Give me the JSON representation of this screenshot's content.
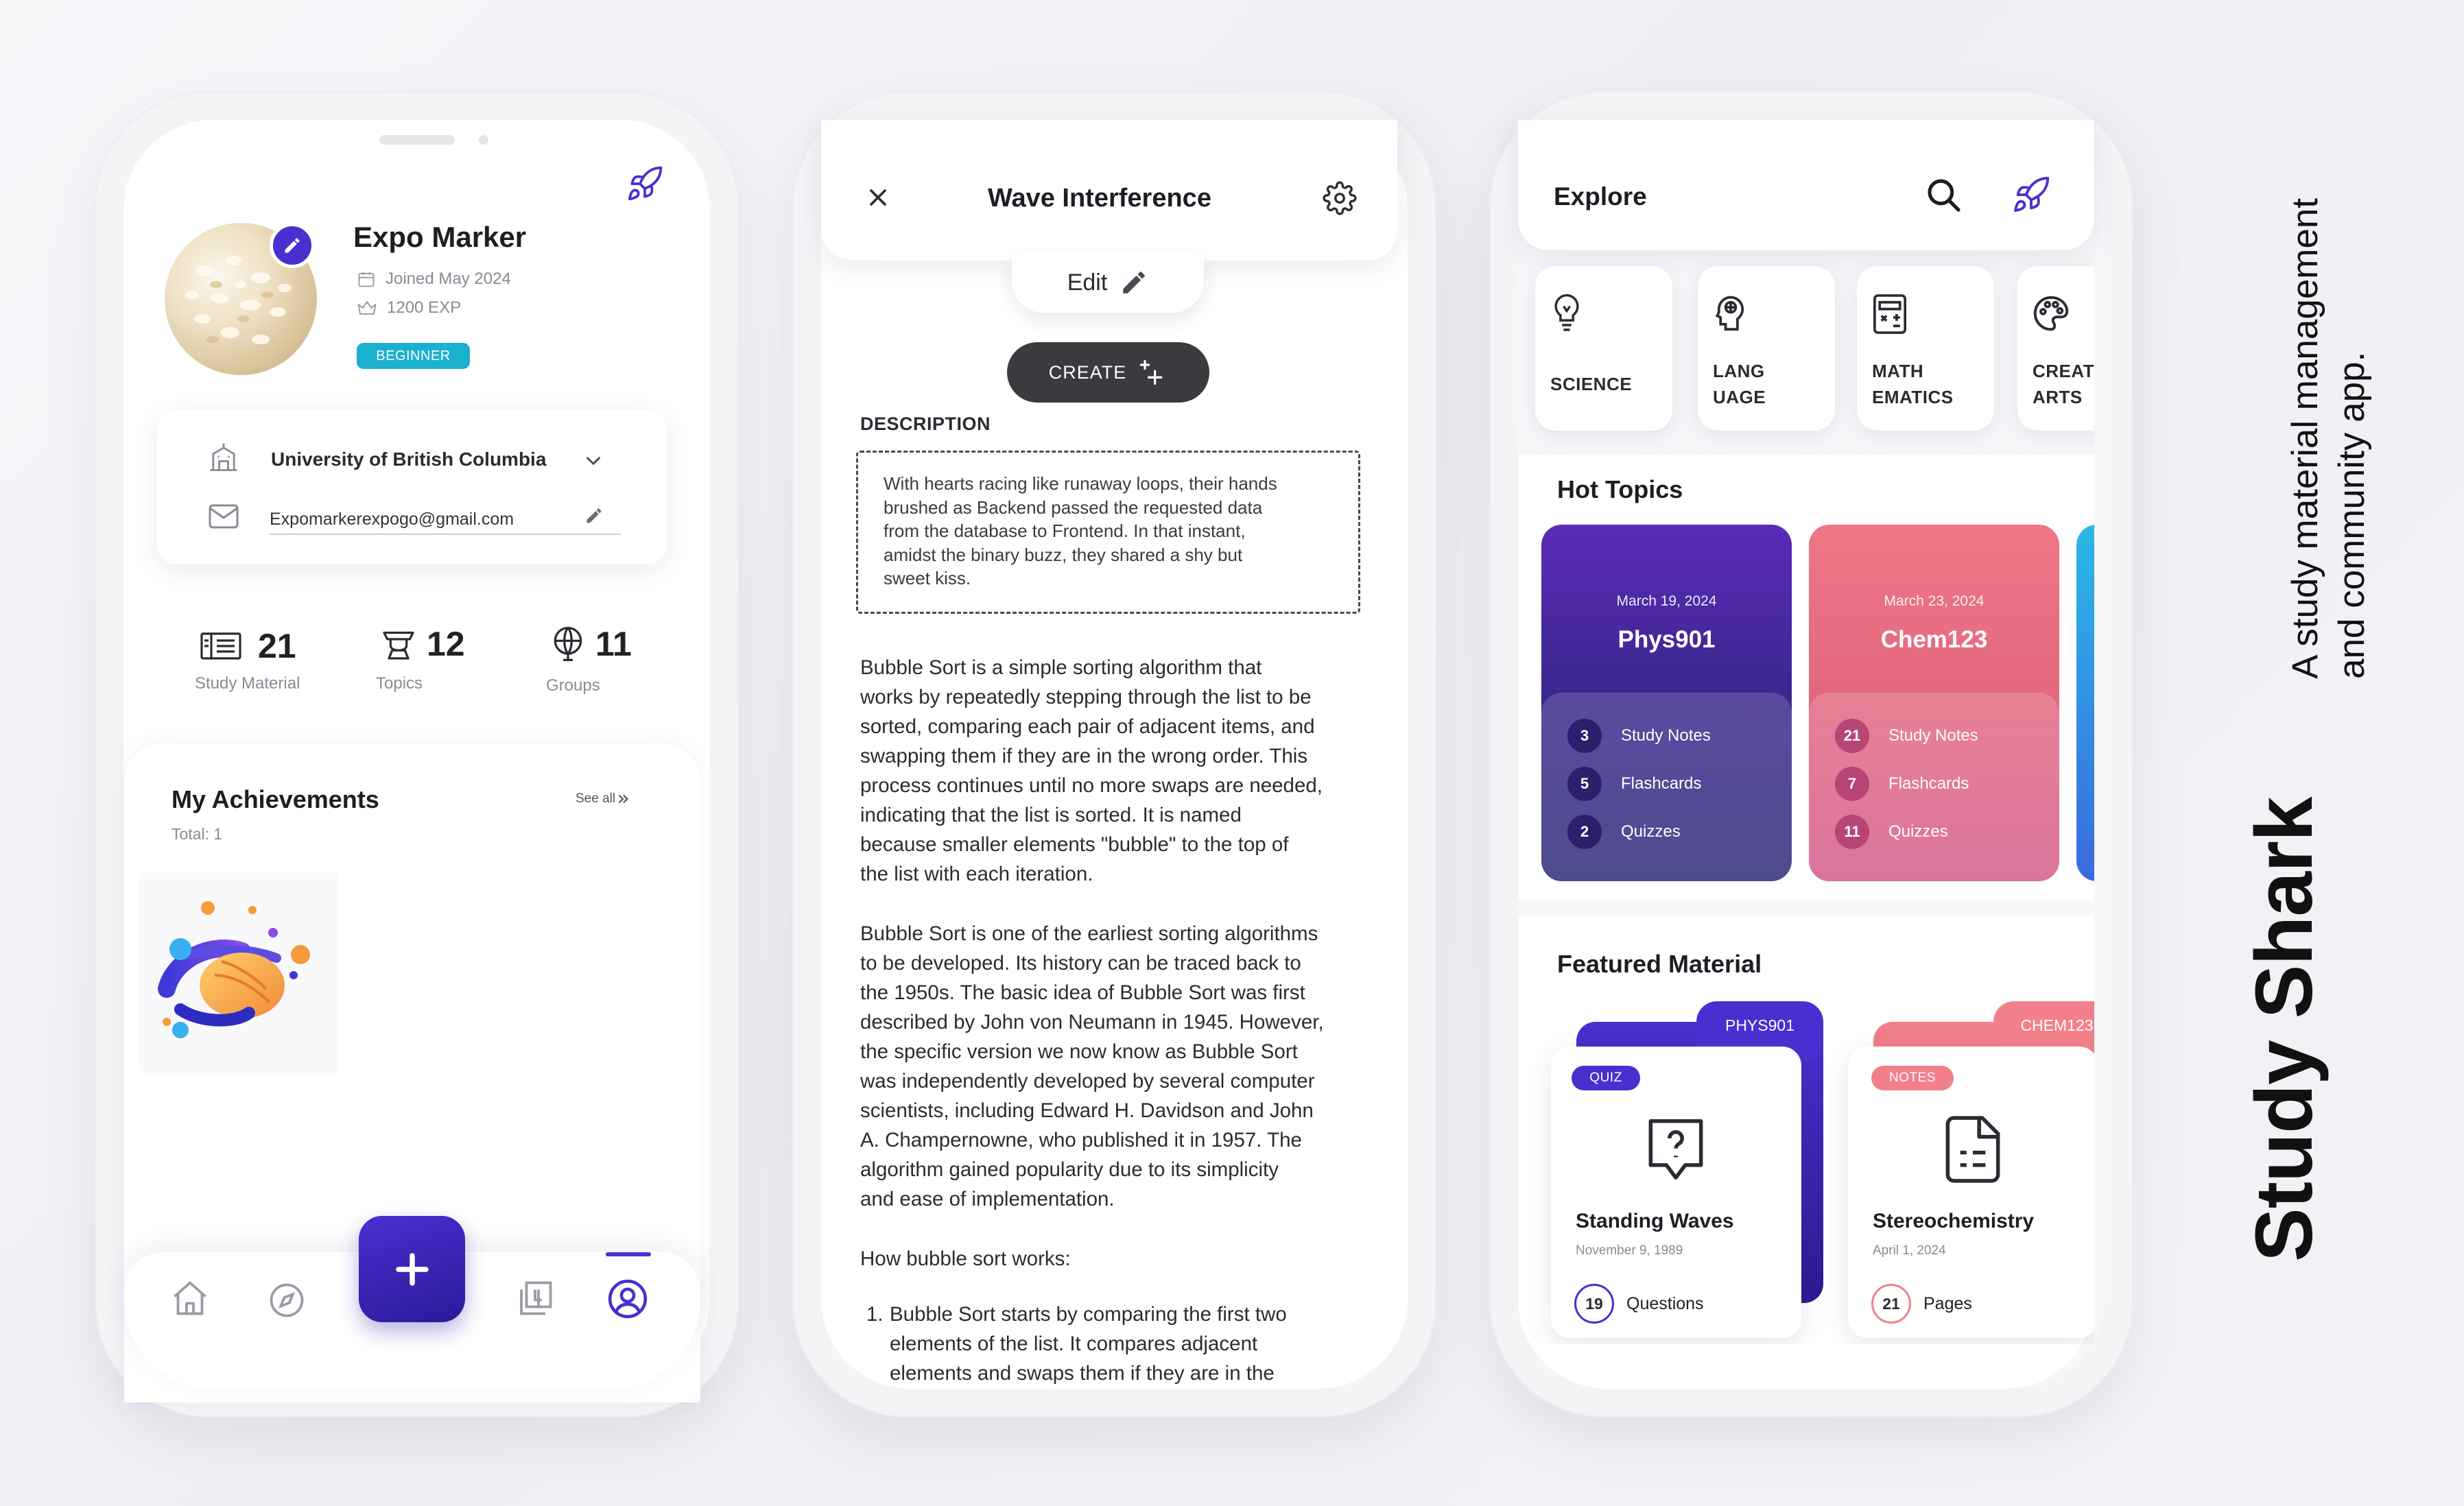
{
  "brand": {
    "title": "Study Shark",
    "tagline_line1": "A study material management",
    "tagline_line2": "and community app."
  },
  "colors": {
    "accent": "#4a2fd0",
    "hot_purple": "#5a2bb8",
    "hot_pink": "#ee7786",
    "badge_teal": "#1bb0d0"
  },
  "profile": {
    "name": "Expo Marker",
    "joined": "Joined May 2024",
    "exp": "1200 EXP",
    "level_badge": "BEGINNER",
    "university": "University of British Columbia",
    "email": "Expomarkerexpogo@gmail.com",
    "stats": [
      {
        "icon": "book-icon",
        "value": "21",
        "label": "Study Material"
      },
      {
        "icon": "graduation-cap-icon",
        "value": "12",
        "label": "Topics"
      },
      {
        "icon": "globe-people-icon",
        "value": "11",
        "label": "Groups"
      }
    ],
    "achievements": {
      "title": "My Achievements",
      "see_all": "See all",
      "total": "Total: 1"
    },
    "nav": [
      "home-icon",
      "compass-icon",
      "add-button",
      "library-icon",
      "profile-icon"
    ],
    "nav_active": "profile-icon"
  },
  "note": {
    "title": "Wave Interference",
    "edit_label": "Edit",
    "create_label": "CREATE",
    "description_heading": "DESCRIPTION",
    "description_lines": [
      "With hearts racing like runaway loops, their hands",
      "brushed as Backend passed the requested data",
      "from the database to Frontend. In that instant,",
      "amidst the binary buzz, they shared a shy but",
      "sweet kiss."
    ],
    "para1_lines": [
      "Bubble Sort is a simple sorting algorithm that",
      "works by repeatedly stepping through the list to be",
      "sorted, comparing each pair of adjacent items, and",
      "swapping them if they are in the wrong order. This",
      "process continues until no more swaps are needed,",
      "indicating that the list is sorted. It is named",
      "because smaller elements \"bubble\" to the top of",
      "the list with each iteration."
    ],
    "para2_lines": [
      "Bubble Sort is one of the earliest sorting algorithms",
      "to be developed. Its history can be traced back to",
      "the 1950s. The basic idea of Bubble Sort was first",
      "described by John von Neumann in 1945. However,",
      "the specific version we now know as Bubble Sort",
      "was independently developed by several computer",
      "scientists, including Edward H. Davidson and John",
      "A. Champernowne, who published it in 1957. The",
      "algorithm gained popularity due to its simplicity",
      "and ease of implementation."
    ],
    "para3": "How bubble sort works:",
    "list_marker": "1.",
    "list_lines": [
      "Bubble Sort starts by comparing the first two",
      "elements of the list. It compares adjacent",
      "elements and swaps them if they are in the"
    ]
  },
  "explore": {
    "title": "Explore",
    "categories": [
      {
        "icon": "lightbulb-icon",
        "line1": "SCIENCE",
        "line2": ""
      },
      {
        "icon": "language-head-icon",
        "line1": "LANG",
        "line2": "UAGE"
      },
      {
        "icon": "calculator-icon",
        "line1": "MATH",
        "line2": "EMATICS"
      },
      {
        "icon": "palette-icon",
        "line1": "CREAT",
        "line2": "ARTS"
      }
    ],
    "hot_title": "Hot Topics",
    "hot": [
      {
        "date": "March 19, 2024",
        "code": "Phys901",
        "notes": "3",
        "flash": "5",
        "quiz": "2"
      },
      {
        "date": "March 23, 2024",
        "code": "Chem123",
        "notes": "21",
        "flash": "7",
        "quiz": "11"
      }
    ],
    "hot_labels": {
      "notes": "Study Notes",
      "flash": "Flashcards",
      "quiz": "Quizzes"
    },
    "featured_title": "Featured Material",
    "featured": [
      {
        "tab": "PHYS901",
        "badge": "QUIZ",
        "icon": "quiz-bubble-icon",
        "title": "Standing Waves",
        "date": "November 9, 1989",
        "count": "19",
        "unit": "Questions"
      },
      {
        "tab": "CHEM123",
        "badge": "NOTES",
        "icon": "document-icon",
        "title": "Stereochemistry",
        "date": "April 1, 2024",
        "count": "21",
        "unit": "Pages"
      }
    ]
  }
}
